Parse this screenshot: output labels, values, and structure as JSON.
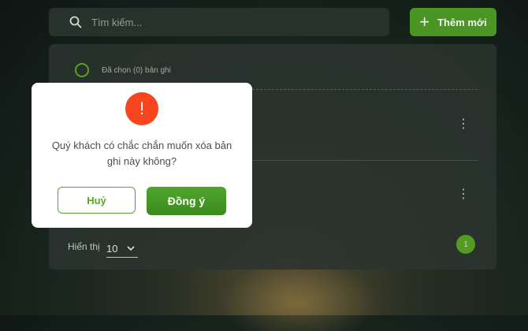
{
  "search": {
    "placeholder": "Tìm kiếm..."
  },
  "toolbar": {
    "add_label": "Thêm mới",
    "add_icon": "plus-icon",
    "accent": "#4f9e26"
  },
  "list": {
    "selected_label": "Đã chọn (0) bản ghi"
  },
  "footer": {
    "show_label": "Hiển thị",
    "page_size": "10",
    "page": "1"
  },
  "dialog": {
    "icon": "warning-icon",
    "icon_text": "!",
    "message": "Quý khách có chắc chắn muốn xóa bản ghi này không?",
    "cancel_label": "Huỷ",
    "confirm_label": "Đồng ý",
    "danger_color": "#f5461f"
  }
}
